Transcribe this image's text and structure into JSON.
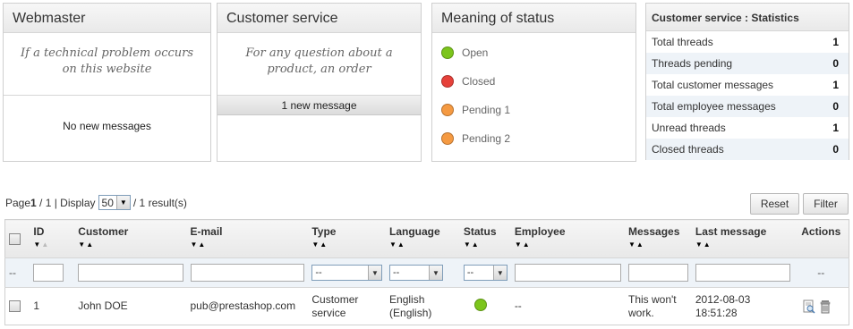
{
  "panels": {
    "webmaster": {
      "title": "Webmaster",
      "description": "If a technical problem occurs on this website",
      "message": "No new messages"
    },
    "customer_service": {
      "title": "Customer service",
      "description": "For any question about a product, an order",
      "message": "1 new message"
    },
    "status_meaning": {
      "title": "Meaning of status",
      "items": [
        {
          "label": "Open",
          "color": "#7cc51c"
        },
        {
          "label": "Closed",
          "color": "#e6413a"
        },
        {
          "label": "Pending 1",
          "color": "#f59a42"
        },
        {
          "label": "Pending 2",
          "color": "#f59a42"
        }
      ]
    },
    "statistics": {
      "title": "Customer service : Statistics",
      "rows": [
        {
          "label": "Total threads",
          "value": "1"
        },
        {
          "label": "Threads pending",
          "value": "0"
        },
        {
          "label": "Total customer messages",
          "value": "1"
        },
        {
          "label": "Total employee messages",
          "value": "0"
        },
        {
          "label": "Unread threads",
          "value": "1"
        },
        {
          "label": "Closed threads",
          "value": "0"
        }
      ]
    }
  },
  "pager": {
    "page_prefix": "Page",
    "page_current": "1",
    "page_suffix": " / 1 | Display",
    "per_page": "50",
    "results": "/ 1 result(s)"
  },
  "buttons": {
    "reset": "Reset",
    "filter": "Filter"
  },
  "table": {
    "headers": [
      "ID",
      "Customer",
      "E-mail",
      "Type",
      "Language",
      "Status",
      "Employee",
      "Messages",
      "Last message",
      "Actions"
    ],
    "filter_placeholder": "--",
    "select_default": "--",
    "rows": [
      {
        "id": "1",
        "customer": "John DOE",
        "email": "pub@prestashop.com",
        "type": "Customer service",
        "language": "English (English)",
        "status_color": "#7cc51c",
        "employee": "--",
        "messages": "This won't work.",
        "last_message": "2012-08-03 18:51:28"
      }
    ]
  }
}
